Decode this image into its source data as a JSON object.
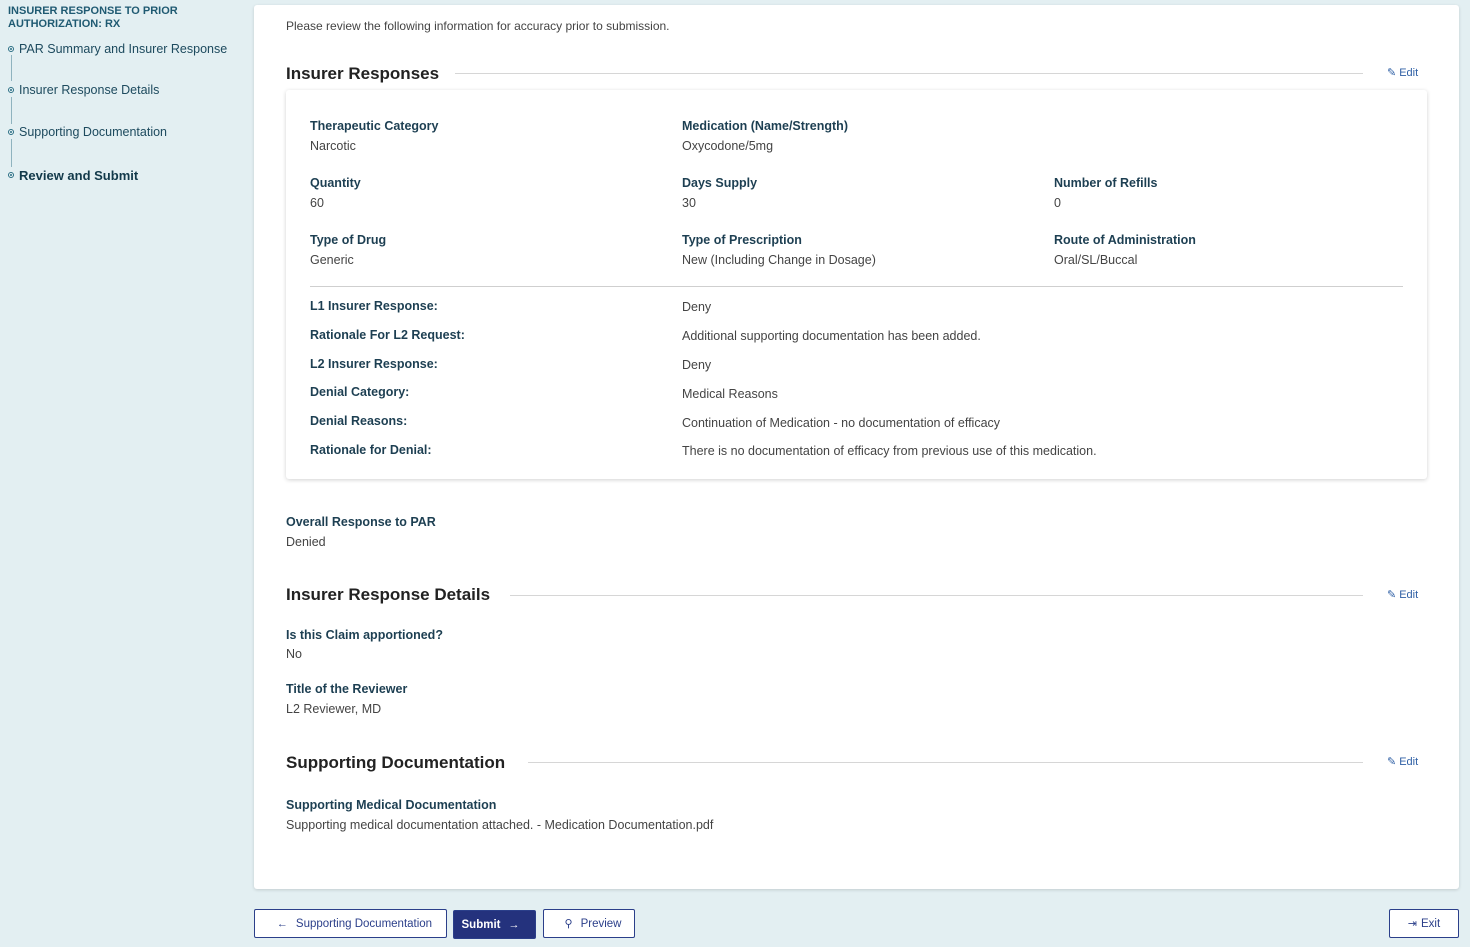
{
  "sidebar": {
    "title": "INSURER RESPONSE TO PRIOR AUTHORIZATION: RX",
    "steps": [
      {
        "label": "PAR Summary and Insurer Response"
      },
      {
        "label": "Insurer Response Details"
      },
      {
        "label": "Supporting Documentation"
      },
      {
        "label": "Review and Submit"
      }
    ]
  },
  "main": {
    "intro": "Please review the following information for accuracy prior to submission.",
    "edit_label": "Edit",
    "insurer_responses": {
      "title": "Insurer Responses",
      "fields": [
        {
          "label": "Therapeutic Category",
          "value": "Narcotic"
        },
        {
          "label": "Medication (Name/Strength)",
          "value": "Oxycodone/5mg"
        },
        {
          "label": "Quantity",
          "value": "60"
        },
        {
          "label": "Days Supply",
          "value": "30"
        },
        {
          "label": "Number of Refills",
          "value": "0"
        },
        {
          "label": "Type of Drug",
          "value": "Generic"
        },
        {
          "label": "Type of Prescription",
          "value": "New (Including Change in Dosage)"
        },
        {
          "label": "Route of Administration",
          "value": "Oral/SL/Buccal"
        }
      ],
      "responses": [
        {
          "label": "L1 Insurer Response:",
          "value": "Deny"
        },
        {
          "label": "Rationale For L2 Request:",
          "value": "Additional supporting documentation has been added."
        },
        {
          "label": "L2 Insurer Response:",
          "value": "Deny"
        },
        {
          "label": "Denial Category:",
          "value": "Medical Reasons"
        },
        {
          "label": "Denial Reasons:",
          "value": "Continuation of Medication - no documentation of efficacy"
        },
        {
          "label": "Rationale for Denial:",
          "value": "There is no documentation of efficacy from previous use of this medication."
        }
      ]
    },
    "overall": {
      "label": "Overall Response to PAR",
      "value": "Denied"
    },
    "response_details": {
      "title": "Insurer Response Details",
      "fields": [
        {
          "label": "Is this Claim apportioned?",
          "value": "No"
        },
        {
          "label": "Title of the Reviewer",
          "value": "L2 Reviewer, MD"
        }
      ]
    },
    "supporting_documentation": {
      "title": "Supporting Documentation",
      "label": "Supporting Medical Documentation",
      "value": "Supporting medical documentation attached.  - Medication Documentation.pdf"
    }
  },
  "footer": {
    "back_label": "Supporting Documentation",
    "submit_label": "Submit",
    "preview_label": "Preview",
    "exit_label": "Exit"
  },
  "colors": {
    "background": "#e3eff2",
    "primary": "#24327d",
    "label": "#1d3f52",
    "link": "#2e5fa5"
  }
}
